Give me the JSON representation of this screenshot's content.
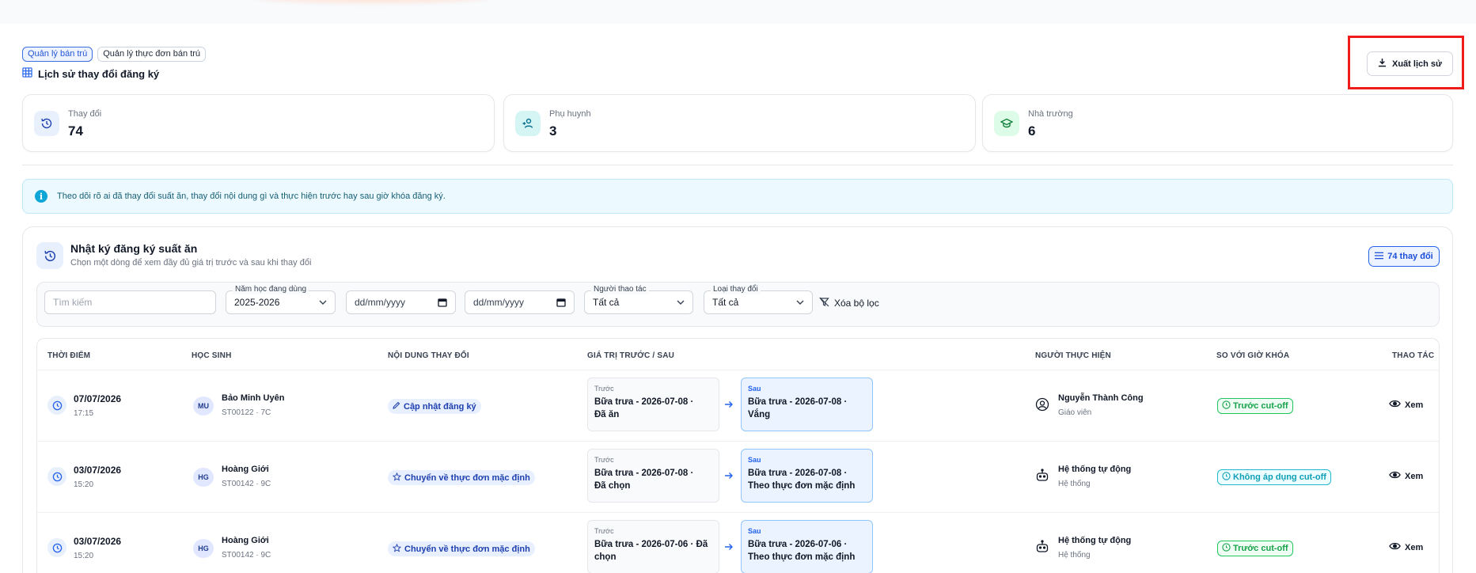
{
  "breadcrumbs": [
    {
      "label": "Quản lý bán trú",
      "active": true
    },
    {
      "label": "Quản lý thực đơn bán trú",
      "active": false
    }
  ],
  "page": {
    "title": "Lịch sử thay đổi đăng ký",
    "title_icon": "table-icon"
  },
  "export_button": {
    "label": "Xuất lịch sử",
    "icon": "download-icon"
  },
  "stats": [
    {
      "label": "Thay đổi",
      "value": "74",
      "icon": "history-icon",
      "color": "#e8f0fe"
    },
    {
      "label": "Phụ huynh",
      "value": "3",
      "icon": "parent-icon",
      "color": "#d5f5f5"
    },
    {
      "label": "Nhà trường",
      "value": "6",
      "icon": "school-icon",
      "color": "#dcfce7"
    }
  ],
  "info_banner": {
    "text": "Theo dõi rõ ai đã thay đổi suất ăn, thay đổi nội dung gì và thực hiện trước hay sau giờ khóa đăng ký."
  },
  "log_panel": {
    "title": "Nhật ký đăng ký suất ăn",
    "subtitle": "Chọn một dòng để xem đầy đủ giá trị trước và sau khi thay đổi",
    "count_label": "74 thay đổi"
  },
  "filters": {
    "search_placeholder": "Tìm kiếm",
    "school_year": {
      "legend": "Năm học đang dùng",
      "value": "2025-2026"
    },
    "date_from_placeholder": "dd/mm/yyyy",
    "date_to_placeholder": "dd/mm/yyyy",
    "actor": {
      "legend": "Người thao tác",
      "value": "Tất cả"
    },
    "change_type": {
      "legend": "Loại thay đổi",
      "value": "Tất cả"
    },
    "clear_label": "Xóa bộ lọc"
  },
  "table": {
    "headers": [
      "THỜI ĐIỂM",
      "HỌC SINH",
      "NỘI DUNG THAY ĐỔI",
      "GIÁ TRỊ TRƯỚC / SAU",
      "NGƯỜI THỰC HIỆN",
      "SO VỚI GIỜ KHÓA",
      "THAO TÁC"
    ],
    "before_caption": "Trước",
    "after_caption": "Sau",
    "view_label": "Xem",
    "rows": [
      {
        "date": "07/07/2026",
        "time": "17:15",
        "initials": "MU",
        "student": "Bảo Minh Uyên",
        "student_id": "ST00122 · 7C",
        "change": "Cập nhật đăng ký",
        "change_icon": "pencil-icon",
        "before_l1": "Bữa trưa - 2026-07-08 ·",
        "before_l2": "Đã ăn",
        "after_l1": "Bữa trưa - 2026-07-08 ·",
        "after_l2": "Vắng",
        "actor": "Nguyễn Thành Công",
        "role": "Giáo viên",
        "actor_icon": "user-icon",
        "cutoff": "Trước cut-off",
        "cutoff_status": "before"
      },
      {
        "date": "03/07/2026",
        "time": "15:20",
        "initials": "HG",
        "student": "Hoàng Giới",
        "student_id": "ST00142 · 9C",
        "change": "Chuyển về thực đơn mặc định",
        "change_icon": "star-icon",
        "before_l1": "Bữa trưa - 2026-07-08 ·",
        "before_l2": "Đã chọn",
        "after_l1": "Bữa trưa - 2026-07-08 ·",
        "after_l2": "Theo thực đơn mặc định",
        "actor": "Hệ thống tự động",
        "role": "Hệ thống",
        "actor_icon": "robot-icon",
        "cutoff": "Không áp dụng cut-off",
        "cutoff_status": "na"
      },
      {
        "date": "03/07/2026",
        "time": "15:20",
        "initials": "HG",
        "student": "Hoàng Giới",
        "student_id": "ST00142 · 9C",
        "change": "Chuyển về thực đơn mặc định",
        "change_icon": "star-icon",
        "before_l1": "Bữa trưa - 2026-07-06 · Đã",
        "before_l2": "chọn",
        "after_l1": "Bữa trưa - 2026-07-06 ·",
        "after_l2": "Theo thực đơn mặc định",
        "actor": "Hệ thống tự động",
        "role": "Hệ thống",
        "actor_icon": "robot-icon",
        "cutoff": "Trước cut-off",
        "cutoff_status": "before"
      }
    ]
  },
  "colors": {
    "accent": "#2563eb",
    "success": "#16a34a",
    "info": "#0ea5d7",
    "highlight": "#ef1c1c"
  }
}
